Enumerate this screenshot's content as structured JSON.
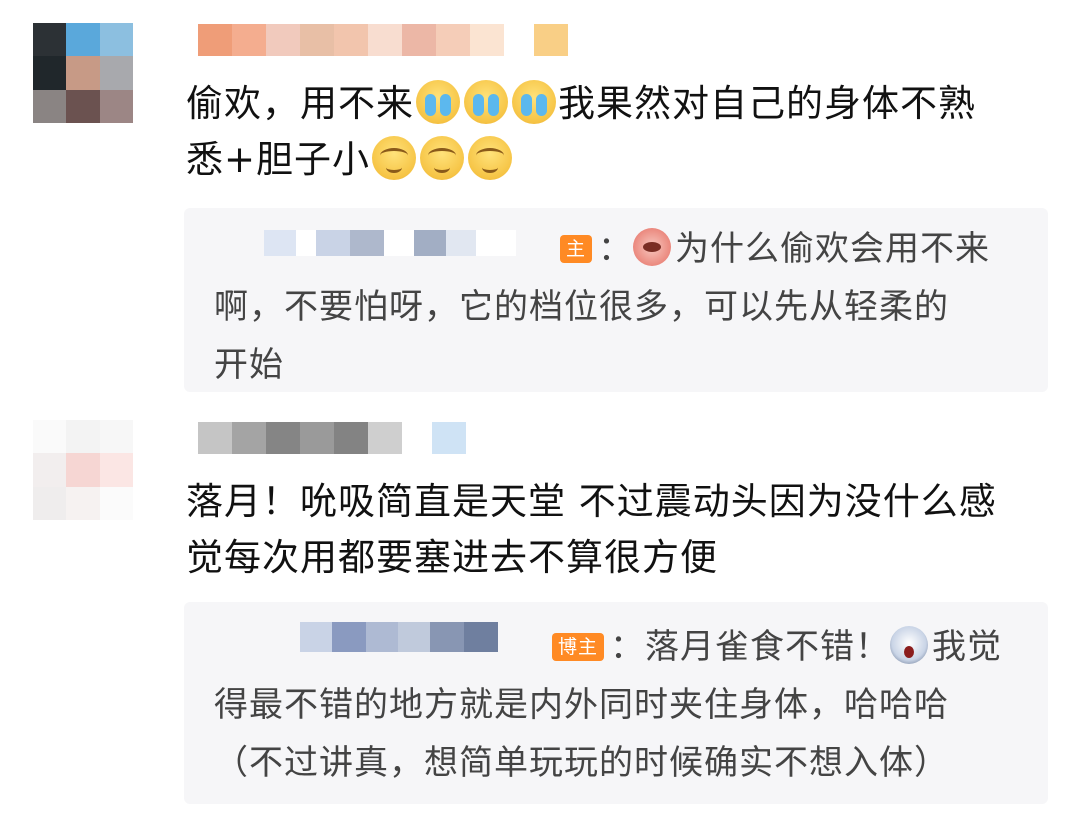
{
  "comments": [
    {
      "text_1": "偷欢，用不来",
      "text_2": "我果然对自己的身体不熟",
      "text_3": "悉+胆子小",
      "emojis_first": [
        "crying-face-icon",
        "crying-face-icon",
        "crying-face-icon"
      ],
      "emojis_second": [
        "dizzy-face-icon",
        "dizzy-face-icon",
        "dizzy-face-icon"
      ],
      "reply": {
        "badge": "主",
        "colon": "：",
        "sticker": "pig-sticker-icon",
        "text_1": "为什么偷欢会用不来",
        "text_2": "啊，不要怕呀，它的档位很多，可以先从轻柔的",
        "text_3": "开始"
      }
    },
    {
      "text_1": "落月！吮吸简直是天堂 不过震动头因为没什么感",
      "text_2": "觉每次用都要塞进去不算很方便",
      "reply": {
        "badge": "博主",
        "colon": "：",
        "text_before": "落月雀食不错！",
        "sticker": "shocked-face-sticker-icon",
        "text_after": "我觉",
        "text_2": "得最不错的地方就是内外同时夹住身体，哈哈哈",
        "text_3": "（不过讲真，想简单玩玩的时候确实不想入体）"
      }
    }
  ],
  "colors": {
    "badge": "#ff8a24",
    "reply_bg": "#f6f6f8",
    "text": "#111111",
    "reply_text": "#444444"
  }
}
